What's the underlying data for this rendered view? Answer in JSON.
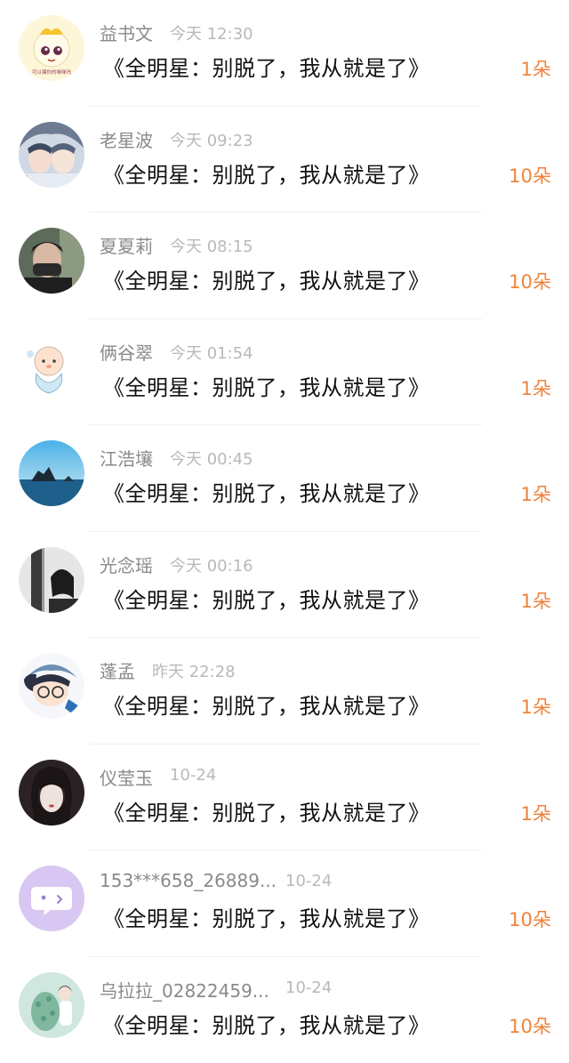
{
  "comments": [
    {
      "name": "益书文",
      "time": "今天 12:30",
      "title": "《全明星：别脱了，我从就是了》",
      "count": "1朵",
      "avatar_badge": "可以摸你的咪咪吗",
      "avatar_icon": "cartoon-bun-avatar"
    },
    {
      "name": "老星波",
      "time": "今天 09:23",
      "title": "《全明星：别脱了，我从就是了》",
      "count": "10朵",
      "avatar_icon": "anime-boys-avatar"
    },
    {
      "name": "夏夏莉",
      "time": "今天 08:15",
      "title": "《全明星：别脱了，我从就是了》",
      "count": "10朵",
      "avatar_icon": "masked-man-avatar"
    },
    {
      "name": "俩谷翠",
      "time": "今天 01:54",
      "title": "《全明星：别脱了，我从就是了》",
      "count": "1朵",
      "avatar_icon": "cartoon-baby-avatar"
    },
    {
      "name": "江浩壤",
      "time": "今天 00:45",
      "title": "《全明星：别脱了，我从就是了》",
      "count": "1朵",
      "avatar_icon": "seascape-avatar"
    },
    {
      "name": "光念瑶",
      "time": "今天 00:16",
      "title": "《全明星：别脱了，我从就是了》",
      "count": "1朵",
      "avatar_icon": "bw-portrait-avatar"
    },
    {
      "name": "蓬孟",
      "time": "昨天 22:28",
      "title": "《全明星：别脱了，我从就是了》",
      "count": "1朵",
      "avatar_icon": "anime-detective-avatar"
    },
    {
      "name": "仪莹玉",
      "time": "10-24",
      "title": "《全明星：别脱了，我从就是了》",
      "count": "1朵",
      "avatar_icon": "girl-portrait-avatar"
    },
    {
      "name": "153***658_26889...",
      "time": "10-24",
      "title": "《全明星：别脱了，我从就是了》",
      "count": "10朵",
      "avatar_icon": "chat-bubble-avatar"
    },
    {
      "name": "乌拉拉_02822459...",
      "time": "10-24",
      "title": "《全明星：别脱了，我从就是了》",
      "count": "10朵",
      "avatar_icon": "plant-illustration-avatar"
    }
  ],
  "colors": {
    "count": "#f0823a",
    "name": "#8a8a8a",
    "time": "#b9b9b9",
    "title": "#111111"
  }
}
